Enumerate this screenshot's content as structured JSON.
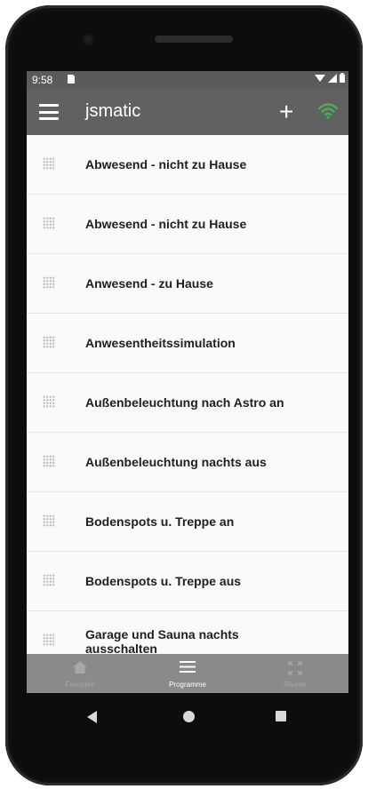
{
  "status_bar": {
    "time": "9:58"
  },
  "app_bar": {
    "title": "jsmatic",
    "add_icon": "plus-icon",
    "wifi_icon": "wifi-icon",
    "wifi_color": "#4caf50"
  },
  "programs": [
    {
      "label": "Abwesend - nicht zu Hause"
    },
    {
      "label": "Abwesend - nicht zu Hause"
    },
    {
      "label": "Anwesend - zu Hause"
    },
    {
      "label": "Anwesentheitssimulation"
    },
    {
      "label": "Außenbeleuchtung nach Astro an"
    },
    {
      "label": "Außenbeleuchtung nachts aus"
    },
    {
      "label": "Bodenspots u. Treppe an"
    },
    {
      "label": "Bodenspots u. Treppe aus"
    },
    {
      "label": "Garage und Sauna nachts ausschalten"
    }
  ],
  "bottom_nav": {
    "favorites": "Favoriten",
    "programs": "Programme",
    "rooms": "Räume",
    "active": "programs"
  }
}
